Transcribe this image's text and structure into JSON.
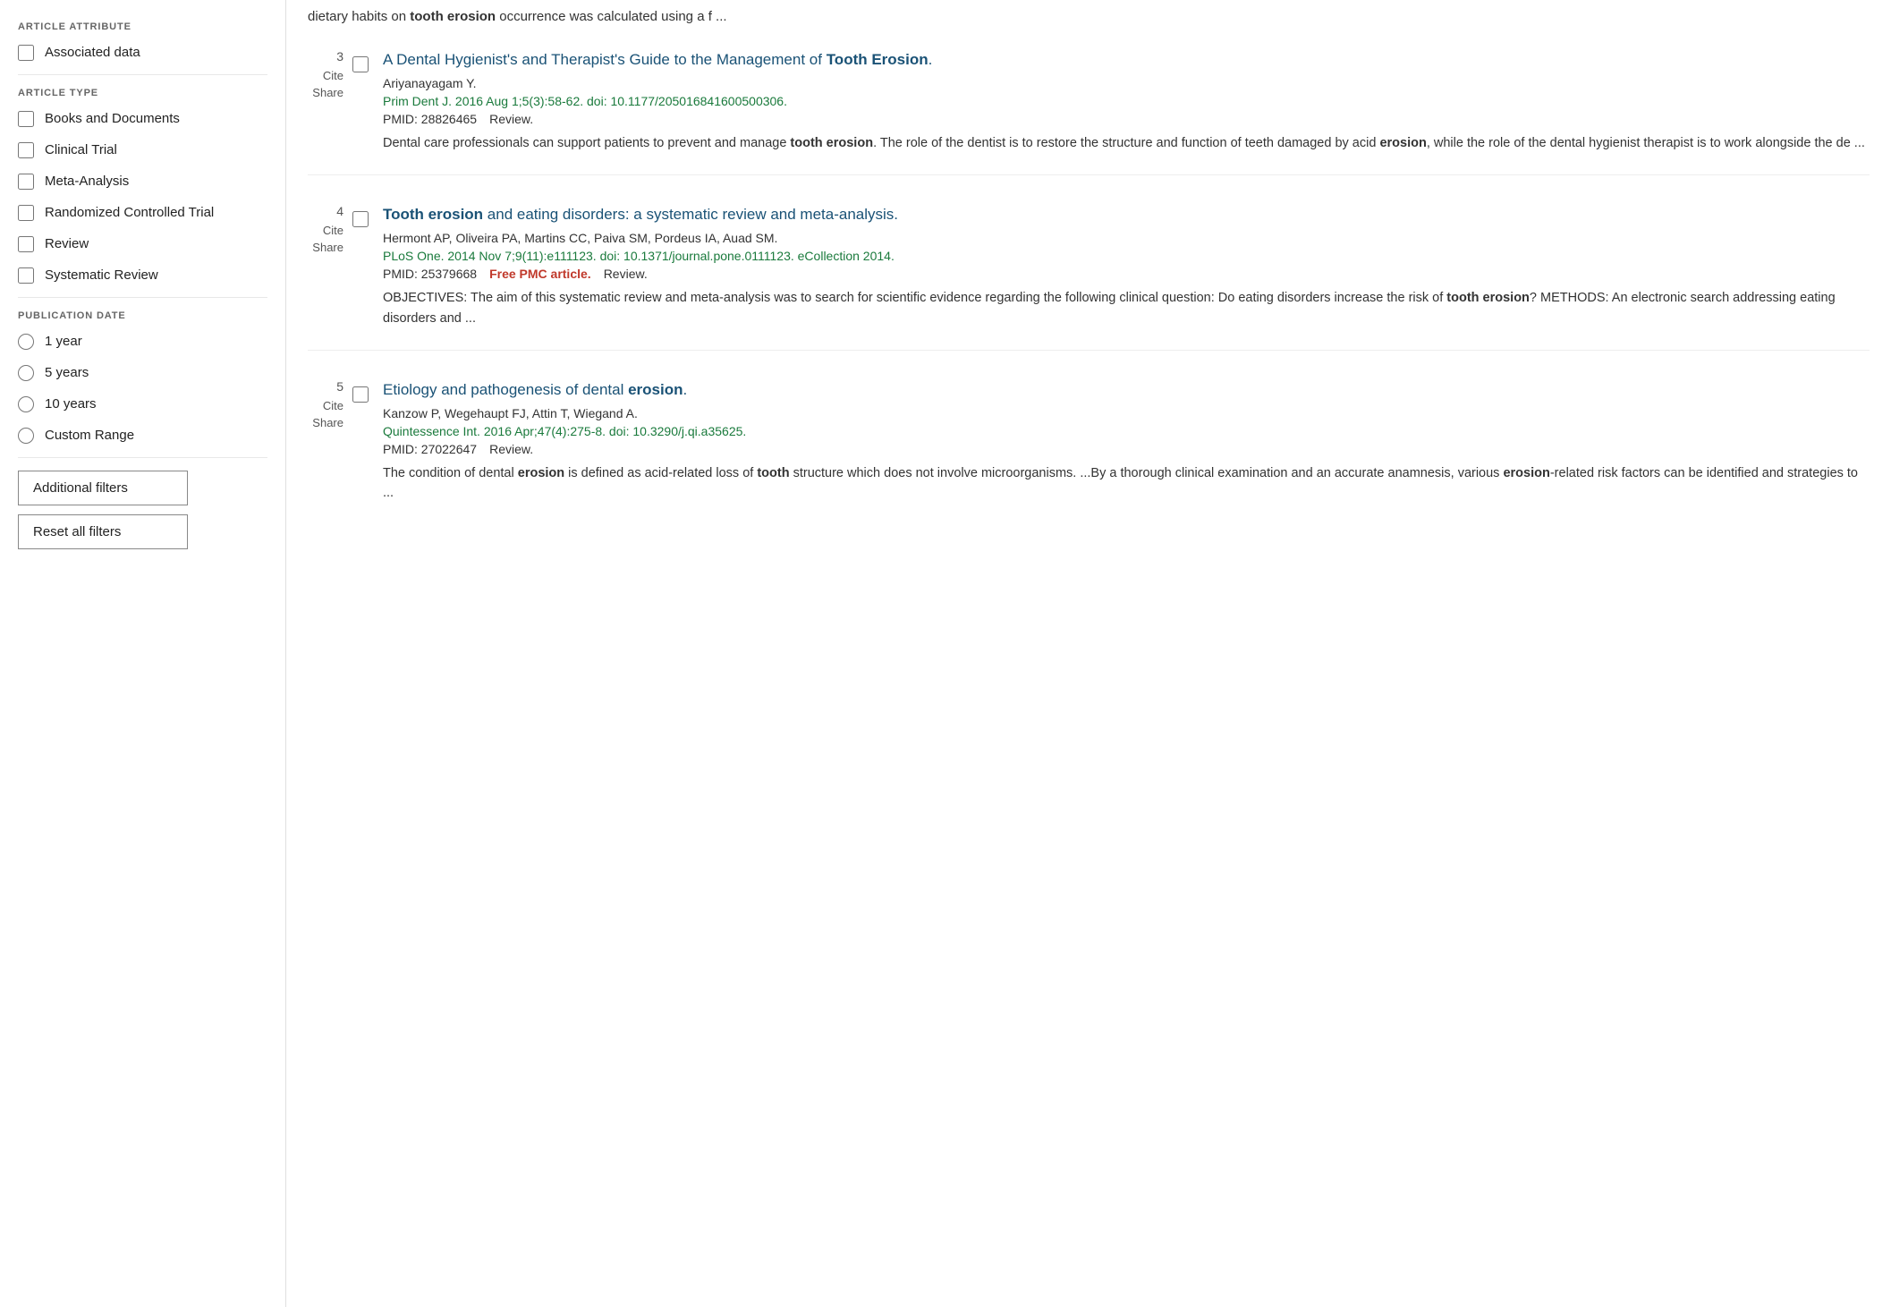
{
  "sidebar": {
    "article_attribute_label": "ARTICLE ATTRIBUTE",
    "article_attribute_items": [
      {
        "id": "associated-data",
        "label": "Associated data",
        "checked": false
      }
    ],
    "article_type_label": "ARTICLE TYPE",
    "article_type_items": [
      {
        "id": "books-documents",
        "label": "Books and Documents",
        "checked": false
      },
      {
        "id": "clinical-trial",
        "label": "Clinical Trial",
        "checked": false
      },
      {
        "id": "meta-analysis",
        "label": "Meta-Analysis",
        "checked": false
      },
      {
        "id": "rct",
        "label": "Randomized Controlled Trial",
        "checked": false
      },
      {
        "id": "review",
        "label": "Review",
        "checked": false
      },
      {
        "id": "systematic-review",
        "label": "Systematic Review",
        "checked": false
      }
    ],
    "publication_date_label": "PUBLICATION DATE",
    "publication_date_items": [
      {
        "id": "1year",
        "label": "1 year"
      },
      {
        "id": "5years",
        "label": "5 years"
      },
      {
        "id": "10years",
        "label": "10 years"
      },
      {
        "id": "custom",
        "label": "Custom Range"
      }
    ],
    "additional_filters_btn": "Additional filters",
    "reset_filters_btn": "Reset all filters"
  },
  "top_snippet": {
    "text_before": "dietary habits on ",
    "bold_word": "tooth erosion",
    "text_after": " occurrence was calculated using a f ..."
  },
  "results": [
    {
      "number": "3",
      "cite_label": "Cite",
      "share_label": "Share",
      "title_parts": [
        {
          "text": "A Dental Hygienist's and Therapist's Guide to the Management of ",
          "bold": false
        },
        {
          "text": "Tooth Erosion",
          "bold": true
        },
        {
          "text": ".",
          "bold": false
        }
      ],
      "title_full": "A Dental Hygienist's and Therapist's Guide to the Management of Tooth Erosion.",
      "authors": "Ariyanayagam Y.",
      "journal": "Prim Dent J. 2016 Aug 1;5(3):58-62. doi: 10.1177/205016841600500306.",
      "pmid": "PMID: 28826465",
      "tags": [
        "Review."
      ],
      "free_pmc": false,
      "abstract": "Dental care professionals can support patients to prevent and manage <strong>tooth erosion</strong>. The role of the dentist is to restore the structure and function of teeth damaged by acid <strong>erosion</strong>, while the role of the dental hygienist therapist is to work alongside the de ..."
    },
    {
      "number": "4",
      "cite_label": "Cite",
      "share_label": "Share",
      "title_parts": [
        {
          "text": "Tooth erosion",
          "bold": true
        },
        {
          "text": " and eating disorders: a systematic review and meta-analysis.",
          "bold": false
        }
      ],
      "title_full": "Tooth erosion and eating disorders: a systematic review and meta-analysis.",
      "authors": "Hermont AP, Oliveira PA, Martins CC, Paiva SM, Pordeus IA, Auad SM.",
      "journal": "PLoS One. 2014 Nov 7;9(11):e111123. doi: 10.1371/journal.pone.0111123. eCollection 2014.",
      "pmid": "PMID: 25379668",
      "tags": [
        "Review."
      ],
      "free_pmc": true,
      "free_pmc_label": "Free PMC article.",
      "abstract": "OBJECTIVES: The aim of this systematic review and meta-analysis was to search for scientific evidence regarding the following clinical question: Do eating disorders increase the risk of <strong>tooth erosion</strong>? METHODS: An electronic search addressing eating disorders and ..."
    },
    {
      "number": "5",
      "cite_label": "Cite",
      "share_label": "Share",
      "title_parts": [
        {
          "text": "Etiology and pathogenesis of dental ",
          "bold": false
        },
        {
          "text": "erosion",
          "bold": true
        },
        {
          "text": ".",
          "bold": false
        }
      ],
      "title_full": "Etiology and pathogenesis of dental erosion.",
      "authors": "Kanzow P, Wegehaupt FJ, Attin T, Wiegand A.",
      "journal": "Quintessence Int. 2016 Apr;47(4):275-8. doi: 10.3290/j.qi.a35625.",
      "pmid": "PMID: 27022647",
      "tags": [
        "Review."
      ],
      "free_pmc": false,
      "abstract": "The condition of dental <strong>erosion</strong> is defined as acid-related loss of <strong>tooth</strong> structure which does not involve microorganisms. ...By a thorough clinical examination and an accurate anamnesis, various <strong>erosion</strong>-related risk factors can be identified and strategies to ..."
    }
  ]
}
